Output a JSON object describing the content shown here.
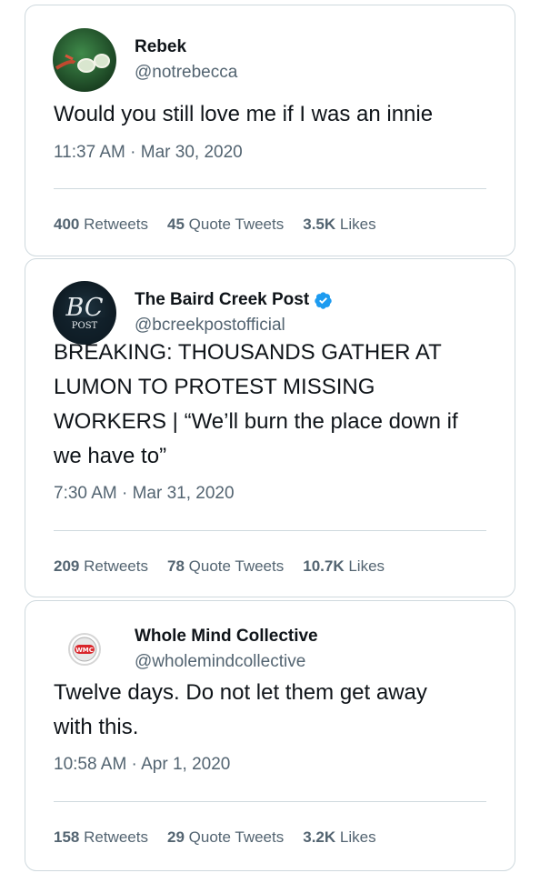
{
  "tweets": [
    {
      "name": "Rebek",
      "handle": "@notrebecca",
      "verified": false,
      "text": "Would you still love me if I was an innie",
      "timestamp": "11:37 AM · Mar 30, 2020",
      "retweets": "400",
      "retweets_label": "Retweets",
      "quotes": "45",
      "quotes_label": "Quote Tweets",
      "likes": "3.5K",
      "likes_label": "Likes"
    },
    {
      "name": "The Baird Creek Post",
      "handle": "@bcreekpostofficial",
      "verified": true,
      "avatar_text_top": "BC",
      "avatar_text_bottom": "POST",
      "text": "BREAKING: THOUSANDS GATHER AT\nLUMON TO PROTEST MISSING\nWORKERS | “We’ll burn the place down if\nwe have to”",
      "timestamp": "7:30 AM · Mar 31, 2020",
      "retweets": "209",
      "retweets_label": "Retweets",
      "quotes": "78",
      "quotes_label": "Quote Tweets",
      "likes": "10.7K",
      "likes_label": "Likes"
    },
    {
      "name": "Whole Mind Collective",
      "handle": "@wholemindcollective",
      "verified": false,
      "avatar_text": "WMC",
      "text": "Twelve days. Do not let them get away\nwith this.",
      "timestamp": "10:58 AM · Apr 1, 2020",
      "retweets": "158",
      "retweets_label": "Retweets",
      "quotes": "29",
      "quotes_label": "Quote Tweets",
      "likes": "3.2K",
      "likes_label": "Likes"
    }
  ],
  "colors": {
    "text": "#0f1419",
    "secondary": "#536471",
    "border": "#cfd9de",
    "verified": "#1d9bf0",
    "wmc_red": "#d9262b"
  },
  "icons": {
    "verified": "verified-badge-icon"
  }
}
